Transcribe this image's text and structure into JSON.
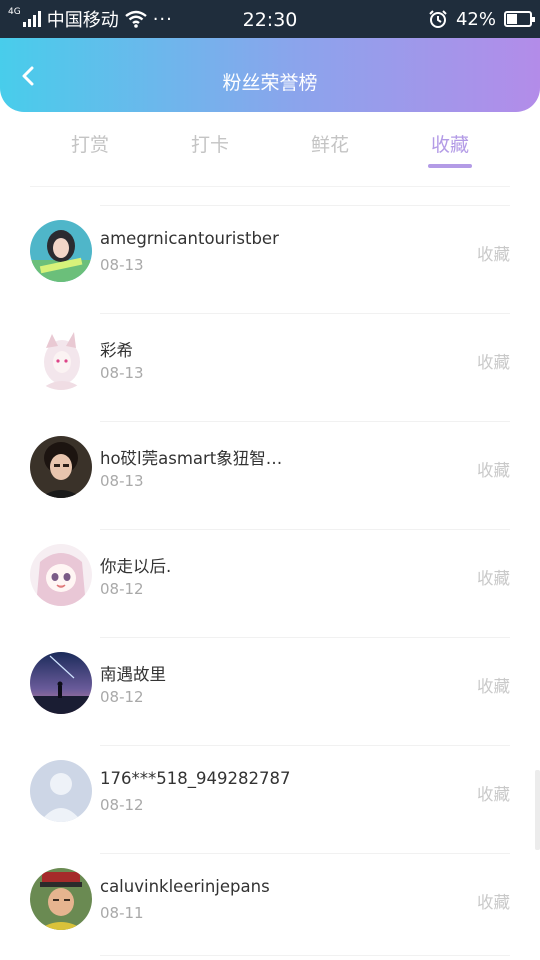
{
  "statusbar": {
    "network_type": "4G",
    "carrier": "中国移动",
    "more": "···",
    "time": "22:30",
    "battery": "42%",
    "battery_level": 0.42
  },
  "header": {
    "title": "粉丝荣誉榜"
  },
  "tabs": [
    {
      "label": "打赏"
    },
    {
      "label": "打卡"
    },
    {
      "label": "鲜花"
    },
    {
      "label": "收藏"
    }
  ],
  "active_tab": "收藏",
  "items": [
    {
      "name": "amegrnicantouristber",
      "date": "08-13",
      "action": "收藏"
    },
    {
      "name": "彩希",
      "date": "08-13",
      "action": "收藏"
    },
    {
      "name": "ho砹l莞asmart象狃智…",
      "date": "08-13",
      "action": "收藏"
    },
    {
      "name": "你走以后.",
      "date": "08-12",
      "action": "收藏"
    },
    {
      "name": "南遇故里",
      "date": "08-12",
      "action": "收藏"
    },
    {
      "name": "176***518_949282787",
      "date": "08-12",
      "action": "收藏"
    },
    {
      "name": "caluvinkleerinjepans",
      "date": "08-11",
      "action": "收藏"
    }
  ],
  "colors": {
    "header_gradient_start": "#48cdeb",
    "header_gradient_end": "#b38ce9",
    "accent": "#b39be6",
    "tab_inactive": "#c4c4c4"
  }
}
